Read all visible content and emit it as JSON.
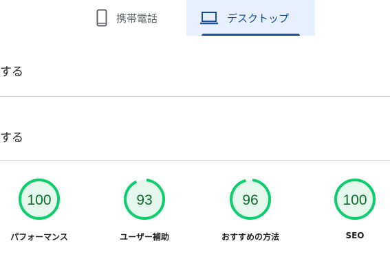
{
  "tabs": {
    "mobile_label": "携帯電話",
    "desktop_label": "デスクトップ",
    "active": "desktop"
  },
  "rows": {
    "row1_text": "する",
    "row2_text": "する"
  },
  "gauges": [
    {
      "label": "パフォーマンス",
      "score": 100
    },
    {
      "label": "ユーザー補助",
      "score": 93
    },
    {
      "label": "おすすめの方法",
      "score": 96
    },
    {
      "label": "SEO",
      "score": 100
    }
  ],
  "colors": {
    "pass_arc": "#0cce6b",
    "pass_fill": "#e6f8ee",
    "pass_text": "#0c6b2c",
    "active_tab_bg": "#e8f0fe",
    "active_tab_accent": "#1a4fa0"
  }
}
